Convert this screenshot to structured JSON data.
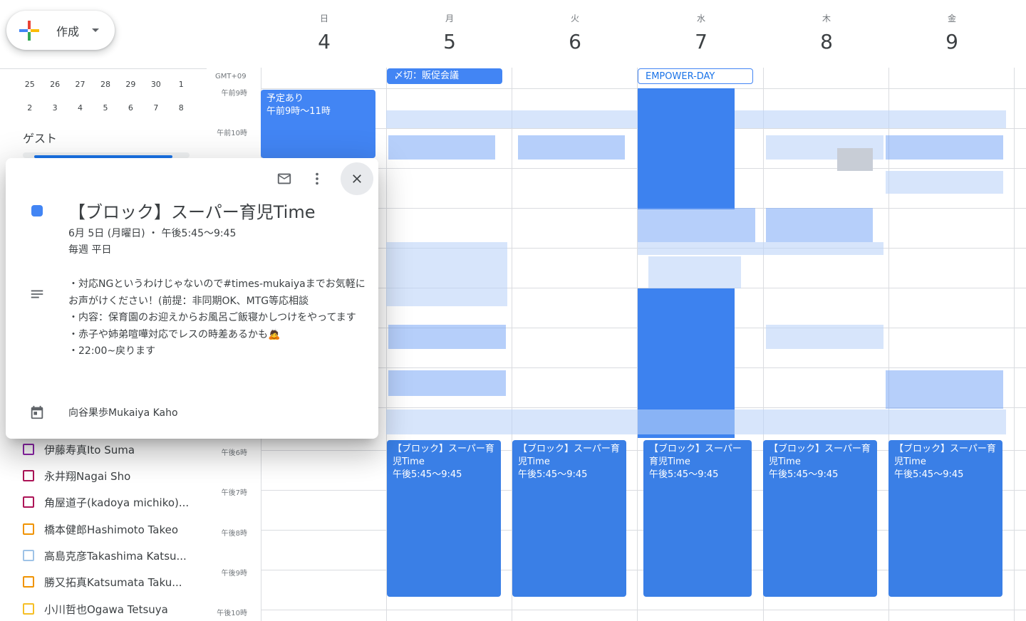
{
  "create": {
    "label": "作成"
  },
  "mini_calendar": {
    "rows": [
      [
        "25",
        "26",
        "27",
        "28",
        "29",
        "30",
        "1"
      ],
      [
        "2",
        "3",
        "4",
        "5",
        "6",
        "7",
        "8"
      ]
    ]
  },
  "guests": {
    "title": "ゲスト",
    "items": [
      {
        "name": "伊藤寿真Ito Suma",
        "color": "#8e24aa"
      },
      {
        "name": "永井翔Nagai Sho",
        "color": "#ad1457"
      },
      {
        "name": "角屋道子(kadoya michiko)...",
        "color": "#ad1457"
      },
      {
        "name": "橋本健郎Hashimoto Takeo",
        "color": "#f09300"
      },
      {
        "name": "高島克彦Takashima Katsu...",
        "color": "#9fc3e7"
      },
      {
        "name": "勝又拓真Katsumata Taku...",
        "color": "#f09300"
      },
      {
        "name": "小川哲也Ogawa Tetsuya",
        "color": "#f6bf26"
      }
    ]
  },
  "timezone": "GMT+09",
  "time_labels": [
    "午前9時",
    "午前10時",
    "午後6時",
    "午後7時",
    "午後8時",
    "午後9時",
    "午後10時"
  ],
  "days": [
    {
      "dow": "日",
      "num": "4"
    },
    {
      "dow": "月",
      "num": "5"
    },
    {
      "dow": "火",
      "num": "6"
    },
    {
      "dow": "水",
      "num": "7"
    },
    {
      "dow": "木",
      "num": "8"
    },
    {
      "dow": "金",
      "num": "9"
    }
  ],
  "all_day": {
    "mon": "〆切：販促会議",
    "wed": "EMPOWER-DAY"
  },
  "sunday_event": {
    "title": "予定あり",
    "time": "午前9時〜11時"
  },
  "block_events": [
    {
      "title": "【ブロック】スーパー育児Time",
      "time": "午後5:45〜9:45"
    },
    {
      "title": "【ブロック】スーパー育児Time",
      "time": "午後5:45〜9:45"
    },
    {
      "title": "【ブロック】スーパー育児Time",
      "time": "午後5:45〜9:45"
    },
    {
      "title": "【ブロック】スーパー育児Time",
      "time": "午後5:45〜9:45"
    },
    {
      "title": "【ブロック】スーパー育児Time",
      "time": "午後5:45〜9:45"
    }
  ],
  "popover": {
    "title": "【ブロック】スーパー育児Time",
    "date": "6月 5日 (月曜日) ・ 午後5:45〜9:45",
    "recurrence": "毎週 平日",
    "description": "・対応NGというわけじゃないので#times-mukaiyaまでお気軽にお声がけください！(前提：非同期OK、MTG等応相談\n・内容：保育園のお迎えからお風呂ご飯寝かしつけをやってます\n・赤子や姉弟喧嘩対応でレスの時差あるかも🙇\n・22:00~戻ります",
    "calendar_owner": "向谷果歩Mukaiya Kaho",
    "event_color": "#4285f4"
  },
  "colors": {
    "event_blue": "#4285f4",
    "accent": "#1a73e8"
  }
}
